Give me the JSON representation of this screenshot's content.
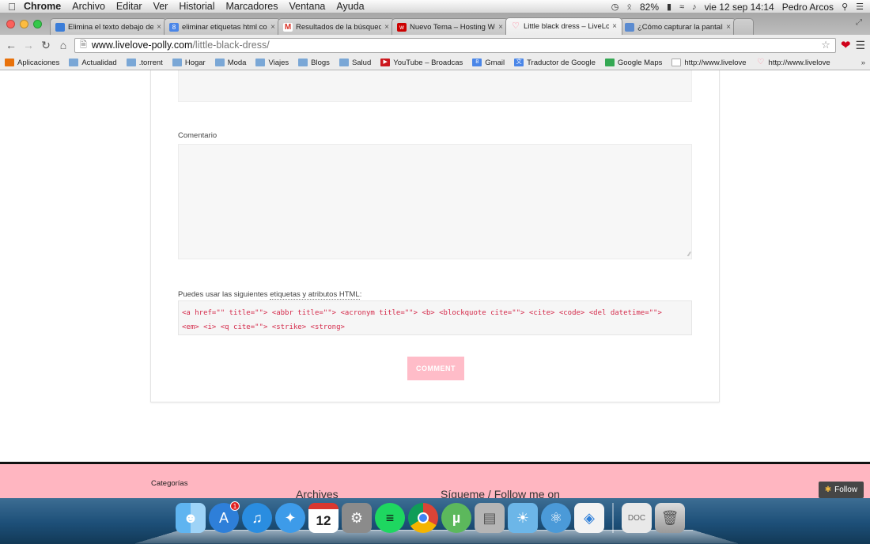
{
  "menubar": {
    "app": "Chrome",
    "items": [
      "Archivo",
      "Editar",
      "Ver",
      "Historial",
      "Marcadores",
      "Ventana",
      "Ayuda"
    ],
    "battery": "82%",
    "datetime": "vie 12 sep  14:14",
    "user": "Pedro Arcos"
  },
  "tabs": [
    {
      "title": "Elimina el texto debajo de",
      "fav_color": "#3b7dd8"
    },
    {
      "title": "eliminar etiquetas html co",
      "fav_color": "#4a86e8",
      "fav_text": "8"
    },
    {
      "title": "Resultados de la búsqueda",
      "fav_color": "#d93025",
      "fav_text": "M"
    },
    {
      "title": "Nuevo Tema – Hosting Wo",
      "fav_color": "#cc0000",
      "fav_text": "w"
    },
    {
      "title": "Little black dress – LiveLo",
      "fav_color": "#ff8fa3",
      "active": true
    },
    {
      "title": "¿Cómo capturar la pantalla",
      "fav_color": "#5b8bd0"
    }
  ],
  "address": {
    "host": "www.livelove-polly.com",
    "path": "/little-black-dress/"
  },
  "bookmarks": [
    {
      "label": "Aplicaciones",
      "color": "#e8710a",
      "kind": "apps"
    },
    {
      "label": "Actualidad",
      "kind": "folder"
    },
    {
      "label": ".torrent",
      "kind": "folder"
    },
    {
      "label": "Hogar",
      "kind": "folder"
    },
    {
      "label": "Moda",
      "kind": "folder"
    },
    {
      "label": "Viajes",
      "kind": "folder"
    },
    {
      "label": "Blogs",
      "kind": "folder"
    },
    {
      "label": "Salud",
      "kind": "folder"
    },
    {
      "label": "YouTube – Broadcas",
      "color": "#cc181e",
      "kind": "site"
    },
    {
      "label": "Gmail",
      "color": "#4a86e8",
      "kind": "site"
    },
    {
      "label": "Traductor de Google",
      "color": "#4a86e8",
      "kind": "site"
    },
    {
      "label": "Google Maps",
      "color": "#34a853",
      "kind": "site"
    },
    {
      "label": "http://www.livelove",
      "color": "#bbbbbb",
      "kind": "page"
    },
    {
      "label": "http://www.livelove",
      "color": "#ff8fa3",
      "kind": "site"
    }
  ],
  "bookmarks_more": "»",
  "comment_form": {
    "comment_label": "Comentario",
    "hint_prefix": "Puedes usar las siguientes ",
    "hint_abbr": "etiquetas y atributos HTML",
    "hint_suffix": ":",
    "allowed_tags_line1": "<a href=\"\" title=\"\"> <abbr title=\"\"> <acronym title=\"\"> <b> <blockquote cite=\"\"> <cite> <code> <del datetime=\"\">",
    "allowed_tags_line2": "<em> <i> <q cite=\"\"> <strike> <strong>",
    "submit_label": "COMMENT",
    "submit_color": "#ffbcc8"
  },
  "footer": {
    "categories": "Categorías",
    "archives": "Archives",
    "follow_me": "Sígueme / Follow me on",
    "bg_color": "#ffb6c1"
  },
  "follow_button": "Follow",
  "dock": {
    "appstore_badge": "1",
    "calendar_day": "12",
    "icons": [
      "finder-icon",
      "appstore-icon",
      "itunes-icon",
      "safari-icon",
      "calendar-icon",
      "system-prefs-icon",
      "spotify-icon",
      "chrome-icon",
      "utorrent-icon",
      "disk-utility-icon",
      "iphoto-icon",
      "app-icon",
      "preview-icon",
      "documents-icon",
      "trash-icon"
    ]
  }
}
